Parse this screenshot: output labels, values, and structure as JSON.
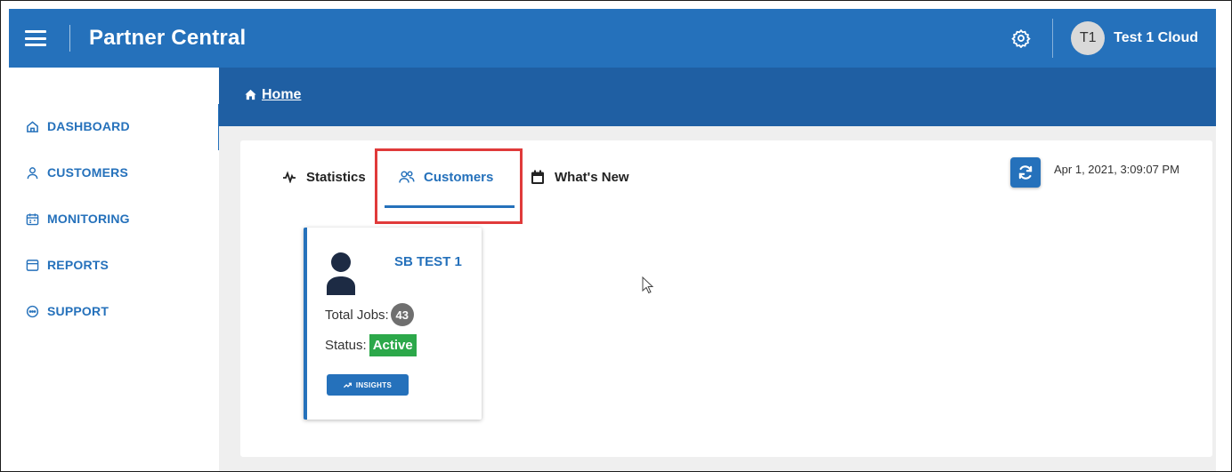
{
  "header": {
    "title": "Partner Central",
    "user_initials": "T1",
    "user_name": "Test 1 Cloud"
  },
  "sidebar": {
    "items": [
      {
        "label": "DASHBOARD",
        "icon": "home-icon",
        "active": true
      },
      {
        "label": "CUSTOMERS",
        "icon": "person-icon"
      },
      {
        "label": "MONITORING",
        "icon": "calendar-icon"
      },
      {
        "label": "REPORTS",
        "icon": "window-icon"
      },
      {
        "label": "SUPPORT",
        "icon": "chat-icon"
      }
    ]
  },
  "breadcrumb": {
    "home": "Home"
  },
  "tabs": [
    {
      "label": "Statistics",
      "icon": "pulse-icon"
    },
    {
      "label": "Customers",
      "icon": "users-icon",
      "active": true
    },
    {
      "label": "What's New",
      "icon": "calendar-icon"
    }
  ],
  "toolbar": {
    "timestamp": "Apr 1, 2021, 3:09:07 PM"
  },
  "customer_card": {
    "name": "SB TEST 1",
    "jobs_label": "Total Jobs:",
    "jobs_count": "43",
    "status_label": "Status:",
    "status_value": "Active",
    "insights_label": "INSIGHTS"
  },
  "colors": {
    "primary": "#2571bb",
    "breadcrumb_bar": "#1f5fa3",
    "status_active": "#2ca84a",
    "highlight": "#e03a3a"
  }
}
